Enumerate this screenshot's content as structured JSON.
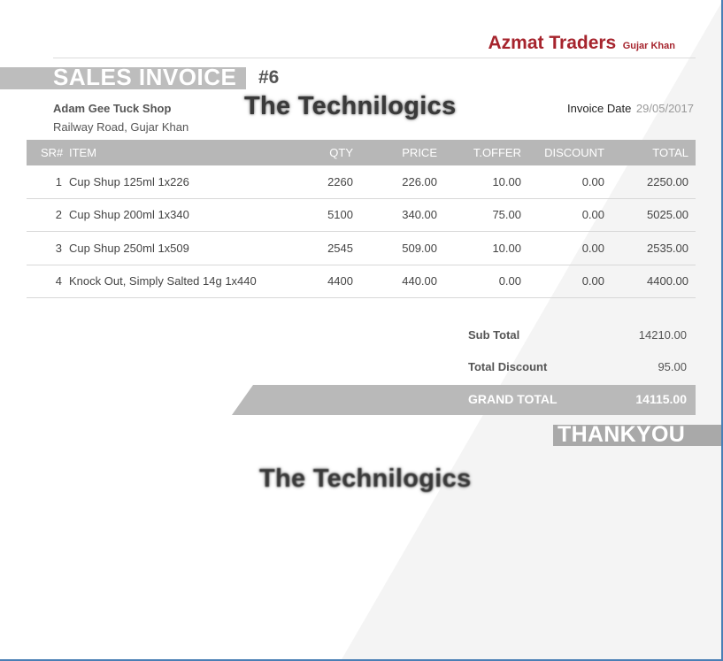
{
  "company": {
    "name": "Azmat Traders",
    "city": "Gujar Khan",
    "brand_color": "#a6242d"
  },
  "invoice": {
    "title": "SALES INVOICE",
    "number": "#6",
    "date_label": "Invoice Date",
    "date": "29/05/2017"
  },
  "customer": {
    "name": "Adam Gee Tuck Shop",
    "address": "Railway Road, Gujar Khan"
  },
  "watermark": {
    "text": "The Technilogics"
  },
  "table": {
    "headers": [
      "SR#",
      "ITEM",
      "QTY",
      "PRICE",
      "T.OFFER",
      "DISCOUNT",
      "TOTAL"
    ],
    "rows": [
      [
        "1",
        "Cup Shup 125ml 1x226",
        "2260",
        "226.00",
        "10.00",
        "0.00",
        "2250.00"
      ],
      [
        "2",
        "Cup Shup 200ml 1x340",
        "5100",
        "340.00",
        "75.00",
        "0.00",
        "5025.00"
      ],
      [
        "3",
        "Cup Shup 250ml 1x509",
        "2545",
        "509.00",
        "10.00",
        "0.00",
        "2535.00"
      ],
      [
        "4",
        "Knock Out, Simply Salted 14g 1x440",
        "4400",
        "440.00",
        "0.00",
        "0.00",
        "4400.00"
      ]
    ]
  },
  "totals": {
    "subtotal_label": "Sub Total",
    "subtotal": "14210.00",
    "discount_label": "Total Discount",
    "discount": "95.00",
    "grand_label": "GRAND TOTAL",
    "grand": "14115.00"
  },
  "footer": {
    "thanks": "THANKYOU"
  },
  "colors": {
    "header_gray": "#b7b7b7",
    "grand_total_gray": "#b9b9b9",
    "background_panel": "#f4f4f4"
  }
}
